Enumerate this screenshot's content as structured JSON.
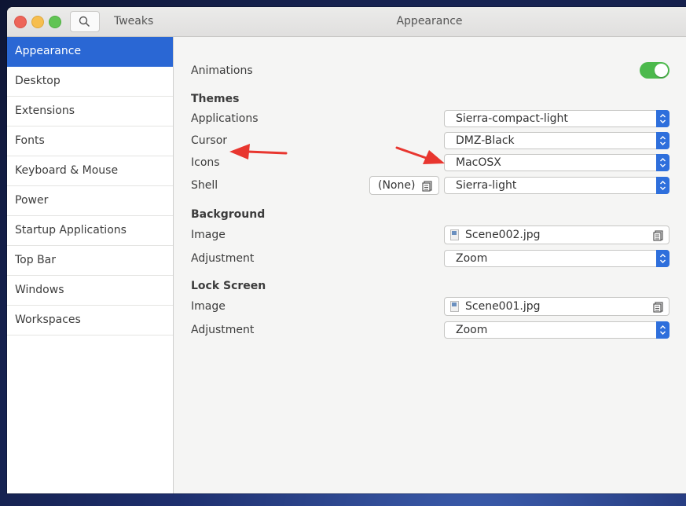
{
  "window": {
    "app_title": "Tweaks",
    "page_title": "Appearance"
  },
  "sidebar": {
    "items": [
      {
        "label": "Appearance"
      },
      {
        "label": "Desktop"
      },
      {
        "label": "Extensions"
      },
      {
        "label": "Fonts"
      },
      {
        "label": "Keyboard & Mouse"
      },
      {
        "label": "Power"
      },
      {
        "label": "Startup Applications"
      },
      {
        "label": "Top Bar"
      },
      {
        "label": "Windows"
      },
      {
        "label": "Workspaces"
      }
    ],
    "active": "Appearance"
  },
  "animations": {
    "label": "Animations",
    "enabled": true
  },
  "themes": {
    "title": "Themes",
    "applications": {
      "label": "Applications",
      "value": "Sierra-compact-light"
    },
    "cursor": {
      "label": "Cursor",
      "value": "DMZ-Black"
    },
    "icons": {
      "label": "Icons",
      "value": "MacOSX"
    },
    "shell": {
      "label": "Shell",
      "button": "(None)",
      "value": "Sierra-light"
    }
  },
  "background": {
    "title": "Background",
    "image": {
      "label": "Image",
      "file": "Scene002.jpg"
    },
    "adjustment": {
      "label": "Adjustment",
      "value": "Zoom"
    }
  },
  "lock_screen": {
    "title": "Lock Screen",
    "image": {
      "label": "Image",
      "file": "Scene001.jpg"
    },
    "adjustment": {
      "label": "Adjustment",
      "value": "Zoom"
    }
  },
  "colors": {
    "accent": "#2a67d4",
    "toggle_on": "#4cb94c",
    "annotation_arrow": "#e8362f"
  }
}
